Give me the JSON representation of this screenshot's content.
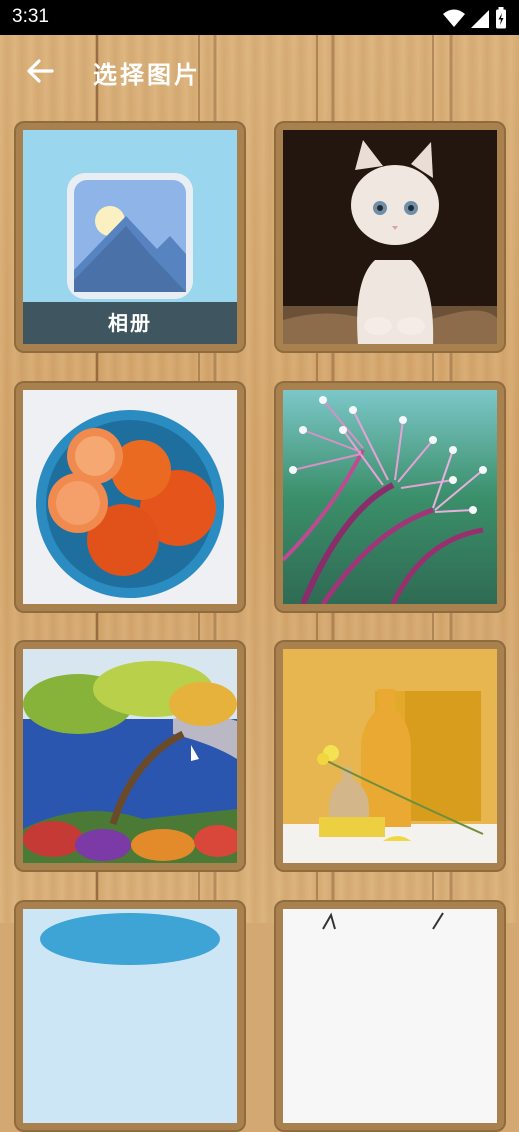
{
  "status_bar": {
    "time": "3:31"
  },
  "app_bar": {
    "title": "选择图片"
  },
  "grid": {
    "items": [
      {
        "type": "album",
        "label": "相册",
        "icon": "gallery-icon"
      },
      {
        "type": "photo",
        "subject": "kitten"
      },
      {
        "type": "photo",
        "subject": "oranges"
      },
      {
        "type": "photo",
        "subject": "dew-flowers"
      },
      {
        "type": "photo",
        "subject": "tree-painting"
      },
      {
        "type": "photo",
        "subject": "vase-still-life"
      },
      {
        "type": "photo",
        "subject": "partial-blue"
      },
      {
        "type": "photo",
        "subject": "partial-sketch"
      }
    ]
  },
  "colors": {
    "status_bar_bg": "#000000",
    "wood": "#d4a872",
    "tile_frame": "#a8814e",
    "album_label_bg": "#3f5660",
    "album_sky": "#9ad6ee"
  }
}
